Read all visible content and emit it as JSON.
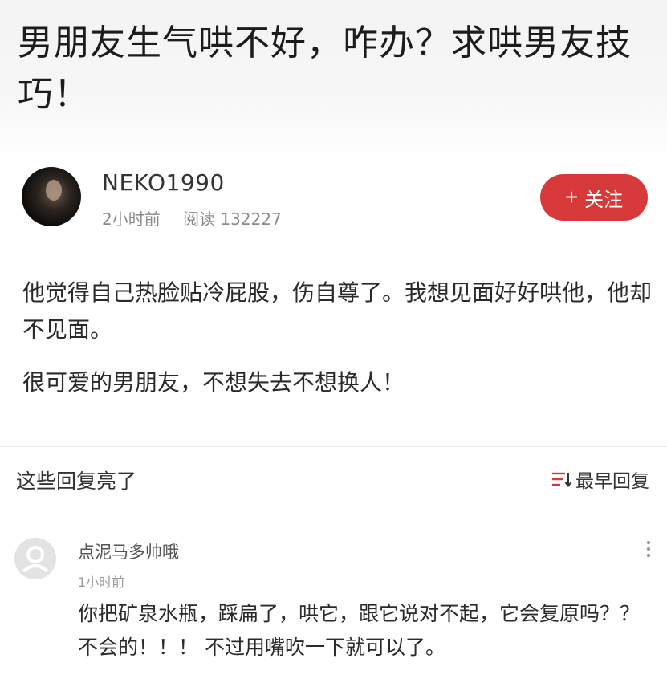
{
  "post": {
    "title": "男朋友生气哄不好，咋办？求哄男友技巧！",
    "body": [
      "他觉得自己热脸贴冷屁股，伤自尊了。我想见面好好哄他，他却不见面。",
      "很可爱的男朋友，不想失去不想换人！"
    ]
  },
  "author": {
    "name": "NEKO1990",
    "time": "2小时前",
    "reads": "阅读 132227",
    "follow_label": "关注",
    "follow_icon": "plus-icon"
  },
  "replies": {
    "section_title": "这些回复亮了",
    "sort_label": "最早回复",
    "sort_icon": "sort-icon",
    "accent_color": "#d7393a",
    "items": [
      {
        "user": "点泥马多帅哦",
        "time": "1小时前",
        "text": "你把矿泉水瓶，踩扁了，哄它，跟它说对不起，它会复原吗？？ 不会的！！！ 不过用嘴吹一下就可以了。",
        "avatar_icon": "default-user-icon",
        "more_icon": "more-vertical-icon"
      }
    ]
  }
}
